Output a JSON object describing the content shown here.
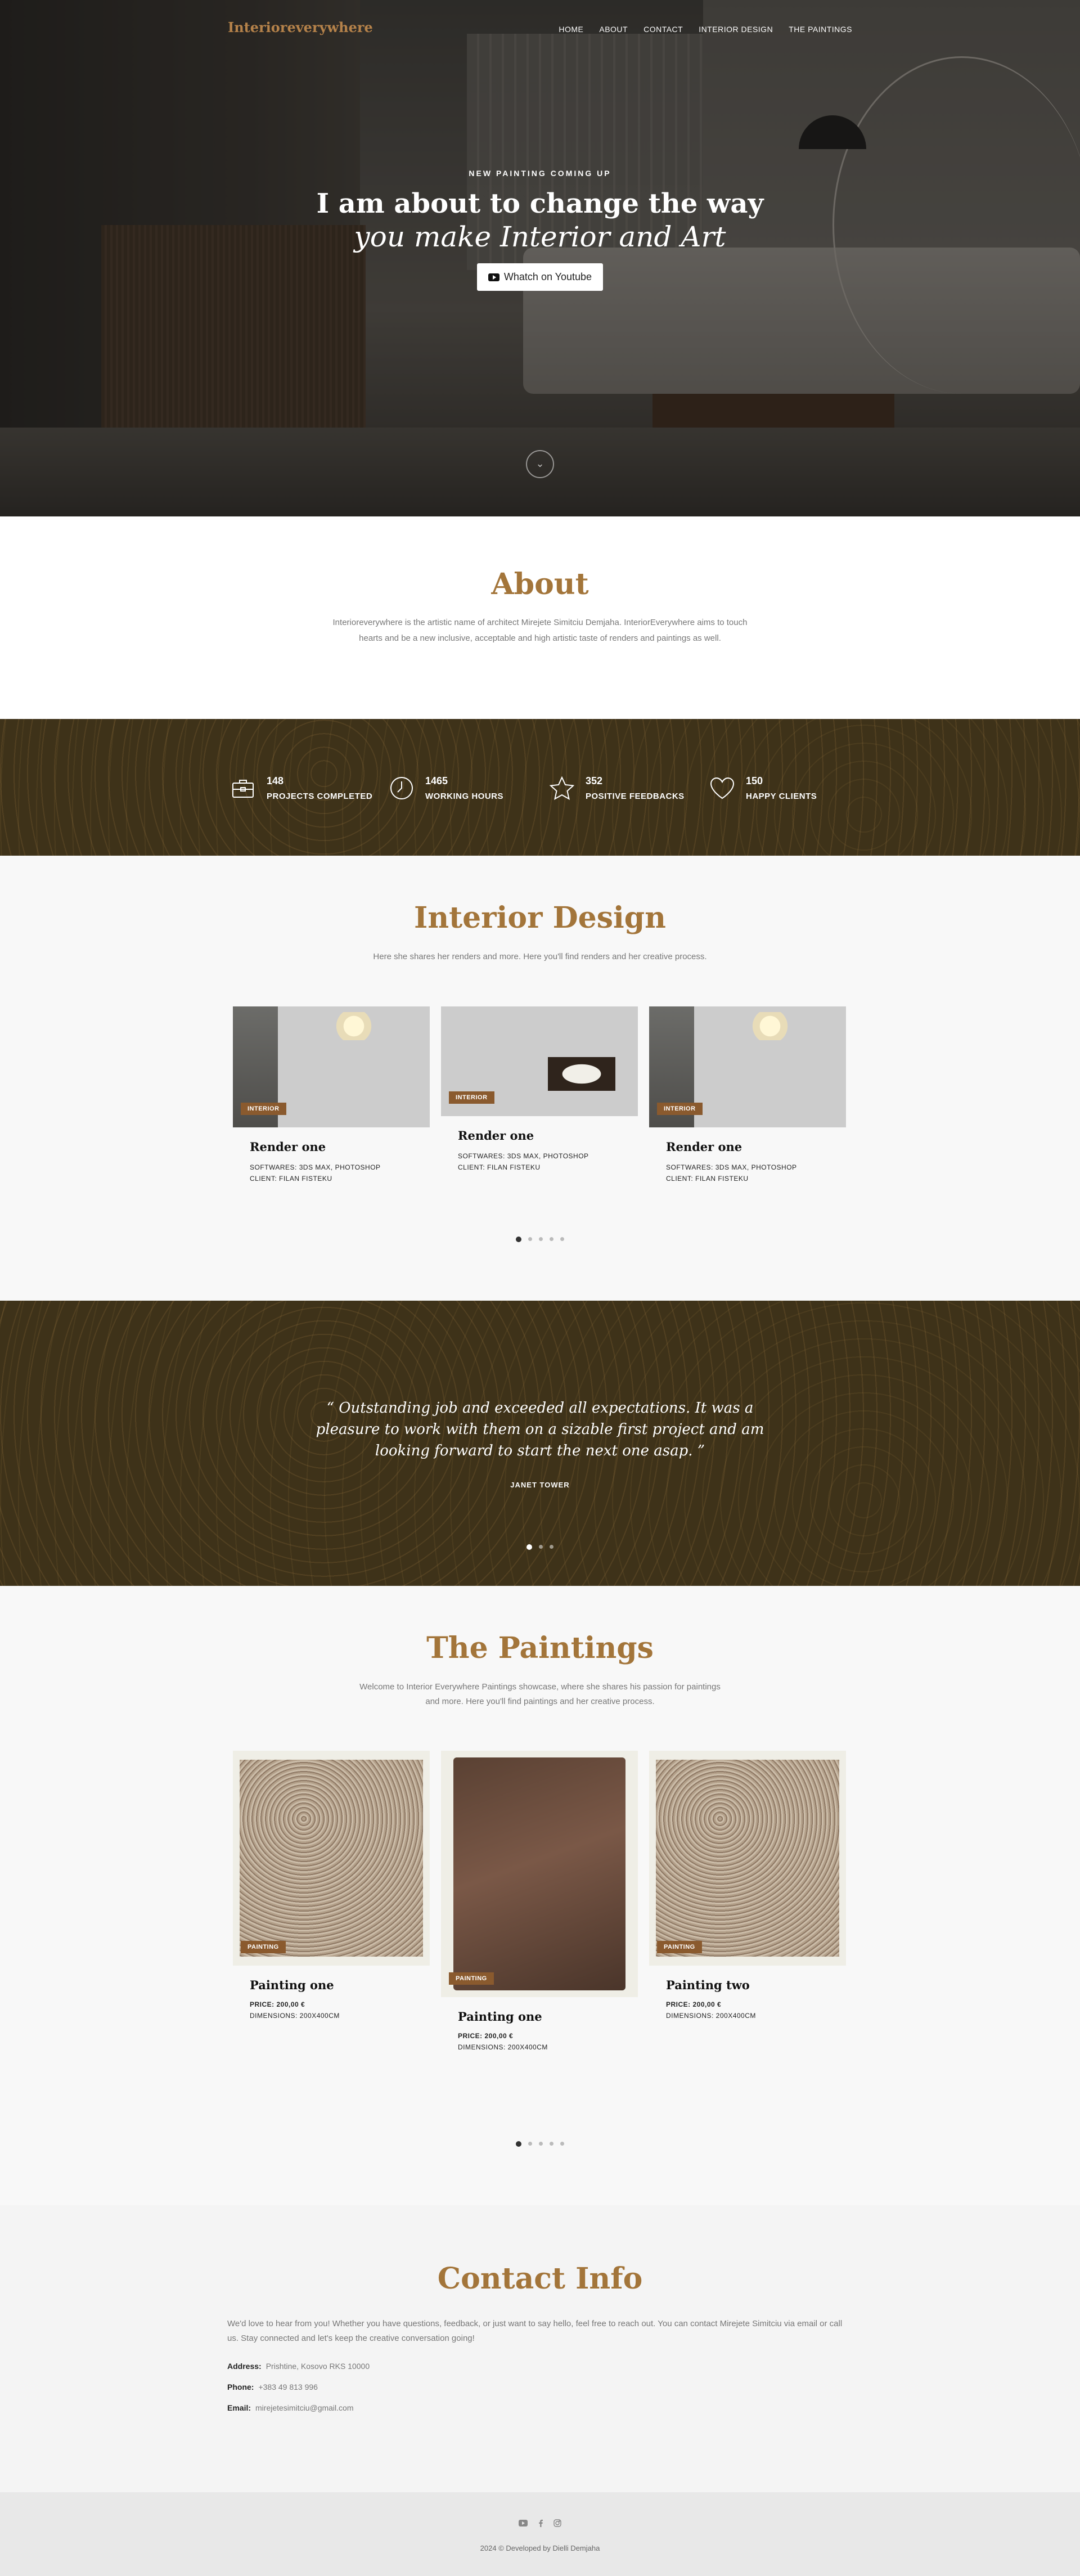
{
  "nav": {
    "brand": "Interioreverywhere",
    "items": [
      "HOME",
      "ABOUT",
      "CONTACT",
      "INTERIOR DESIGN",
      "THE PAINTINGS"
    ]
  },
  "hero": {
    "eyebrow": "NEW PAINTING COMING UP",
    "title_line1": "I am about to change the way",
    "title_line2": "you make Interior and Art",
    "button": "Whatch on Youtube",
    "scroll_icon": "chevron-down-icon"
  },
  "about": {
    "title": "About",
    "text": "Interioreverywhere is the artistic name of architect Mirejete Simitciu Demjaha. InteriorEverywhere aims to touch hearts and be a new inclusive, acceptable and high artistic taste of renders and paintings as well."
  },
  "counters": [
    {
      "icon": "briefcase-icon",
      "number": "148",
      "label": "PROJECTS COMPLETED"
    },
    {
      "icon": "clock-icon",
      "number": "1465",
      "label": "WORKING HOURS"
    },
    {
      "icon": "star-icon",
      "number": "352",
      "label": "POSITIVE FEEDBACKS"
    },
    {
      "icon": "heart-icon",
      "number": "150",
      "label": "HAPPY CLIENTS"
    }
  ],
  "interior": {
    "title": "Interior Design",
    "subtitle": "Here she shares her renders and more. Here you'll find renders and her creative process.",
    "cards": [
      {
        "tag": "INTERIOR",
        "title": "Render one",
        "software": "SOFTWARES: 3DS MAX, PHOTOSHOP",
        "client": "CLIENT: FILAN FISTEKU"
      },
      {
        "tag": "INTERIOR",
        "title": "Render one",
        "software": "SOFTWARES: 3DS MAX, PHOTOSHOP",
        "client": "CLIENT: FILAN FISTEKU"
      },
      {
        "tag": "INTERIOR",
        "title": "Render one",
        "software": "SOFTWARES: 3DS MAX, PHOTOSHOP",
        "client": "CLIENT: FILAN FISTEKU"
      }
    ],
    "dots": 5
  },
  "testimonial": {
    "open_quote": "“",
    "quote": "Outstanding job and exceeded all expectations. It was a pleasure to work with them on a sizable first project and am looking forward to start the next one asap.",
    "close_quote": "”",
    "author": "JANET TOWER",
    "dots": 3
  },
  "paintings": {
    "title": "The Paintings",
    "subtitle_line1": "Welcome to Interior Everywhere Paintings showcase, where she shares his passion for paintings",
    "subtitle_line2": "and more. Here you'll find paintings and her creative process.",
    "cards": [
      {
        "tag": "PAINTING",
        "title": "Painting one",
        "price": "PRICE: 200,00 €",
        "dimensions": "DIMENSIONS: 200X400CM"
      },
      {
        "tag": "PAINTING",
        "title": "Painting one",
        "price": "PRICE: 200,00 €",
        "dimensions": "DIMENSIONS: 200X400CM"
      },
      {
        "tag": "PAINTING",
        "title": "Painting two",
        "price": "PRICE: 200,00 €",
        "dimensions": "DIMENSIONS: 200X400CM"
      }
    ],
    "dots": 5
  },
  "contact": {
    "title": "Contact Info",
    "intro": "We'd love to hear from you! Whether you have questions, feedback, or just want to say hello, feel free to reach out. You can contact Mirejete Simitciu via email or call us. Stay connected and let's keep the creative conversation going!",
    "address_label": "Address:",
    "address": "Prishtine, Kosovo RKS 10000",
    "phone_label": "Phone:",
    "phone": "+383 49 813 996",
    "email_label": "Email:",
    "email": "mirejetesimitciu@gmail.com"
  },
  "footer": {
    "socials": [
      "youtube-icon",
      "facebook-icon",
      "instagram-icon"
    ],
    "copyright": "2024 © Developed by Dielli Demjaha"
  },
  "colors": {
    "accent": "#a3753a",
    "band": "#3e3219",
    "tag": "#8a5a2e"
  }
}
